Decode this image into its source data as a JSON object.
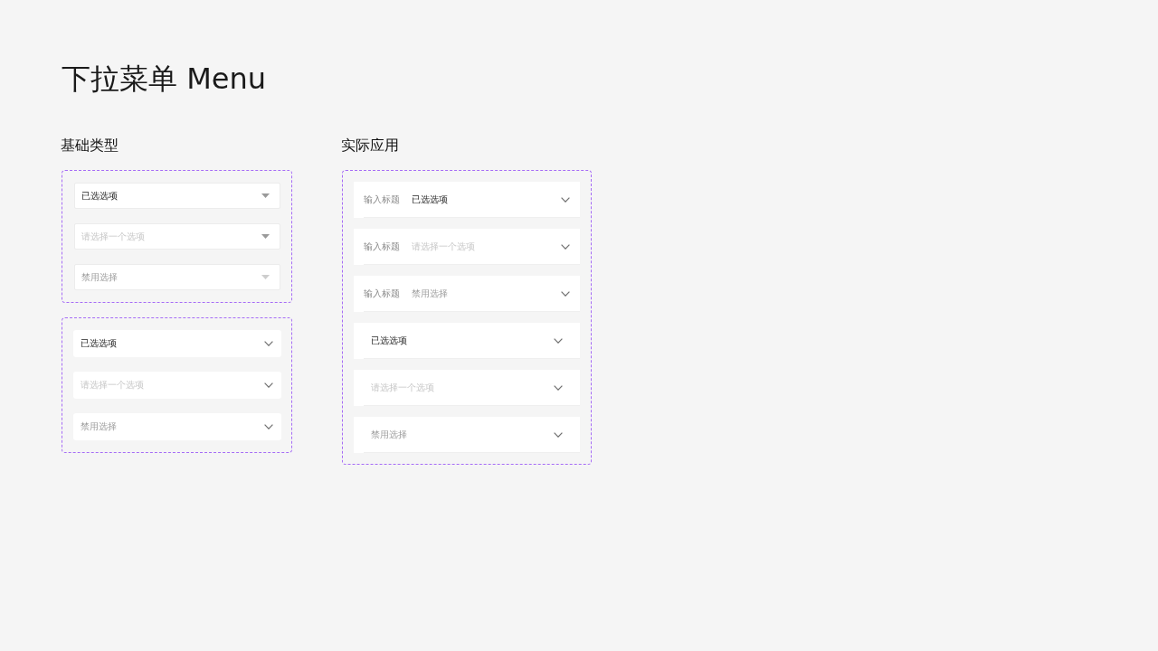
{
  "title": "下拉菜单 Menu",
  "sections": [
    {
      "heading": "基础类型",
      "groups": [
        {
          "kind": "bordered",
          "selects": [
            {
              "value": "已选选项",
              "disabled": false
            },
            {
              "placeholder": "请选择一个选项",
              "disabled": false
            },
            {
              "value": "禁用选择",
              "disabled": true
            }
          ]
        },
        {
          "kind": "plain",
          "selects": [
            {
              "value": "已选选项",
              "disabled": false
            },
            {
              "placeholder": "请选择一个选项",
              "disabled": false
            },
            {
              "value": "禁用选择",
              "disabled": true
            }
          ]
        }
      ]
    },
    {
      "heading": "实际应用",
      "groups": [
        {
          "kind": "list",
          "selects": [
            {
              "label": "输入标题",
              "value": "已选选项",
              "disabled": false
            },
            {
              "label": "输入标题",
              "placeholder": "请选择一个选项",
              "disabled": false
            },
            {
              "label": "输入标题",
              "value": "禁用选择",
              "disabled": true
            },
            {
              "value": "已选选项",
              "disabled": false
            },
            {
              "placeholder": "请选择一个选项",
              "disabled": false
            },
            {
              "value": "禁用选择",
              "disabled": true
            }
          ]
        }
      ]
    }
  ]
}
